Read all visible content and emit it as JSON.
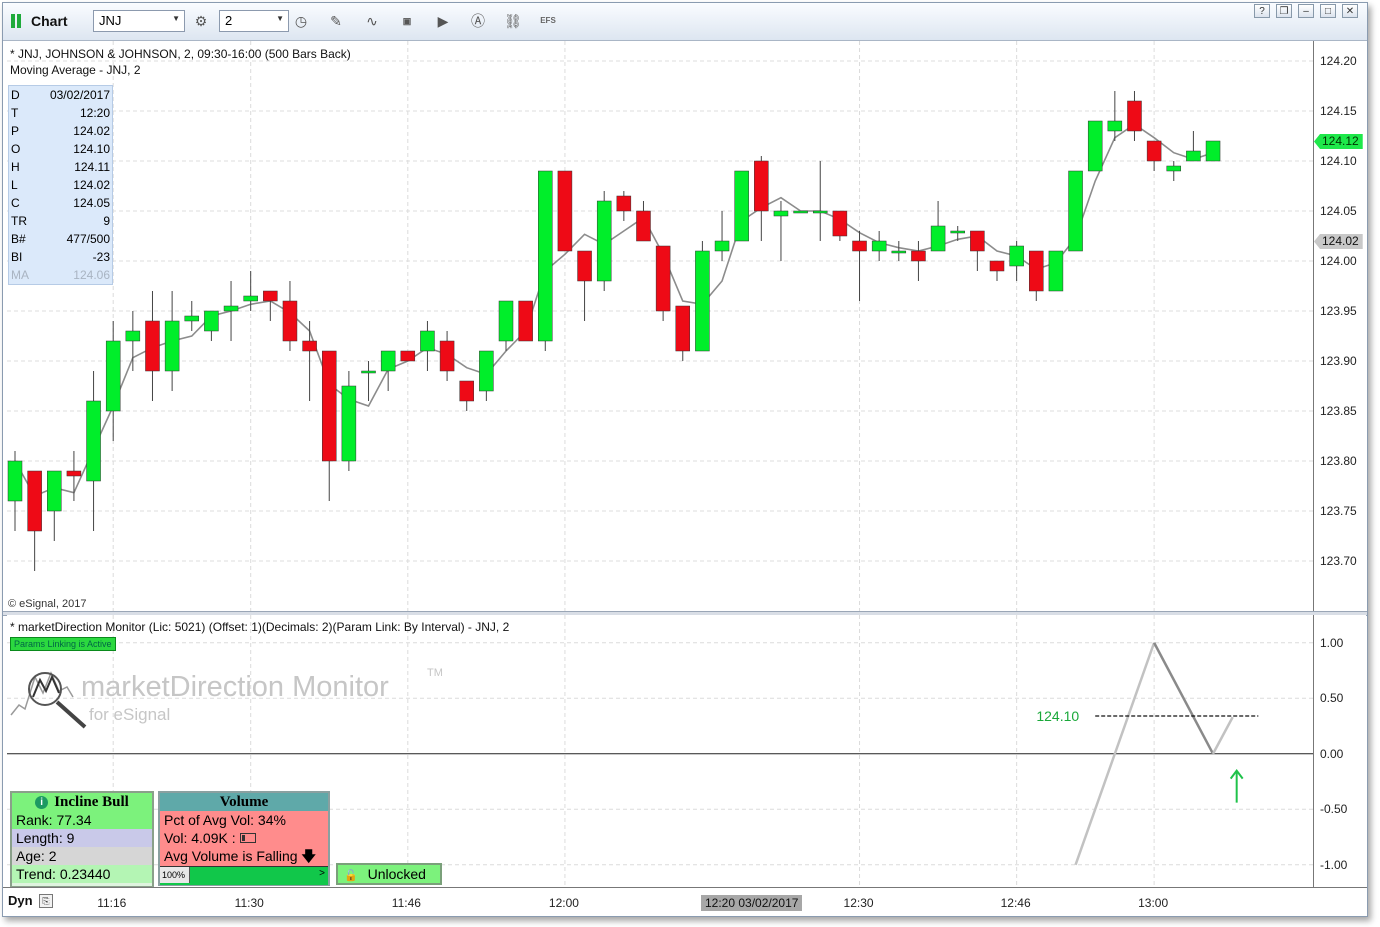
{
  "toolbar": {
    "app_title": "Chart",
    "symbol": "JNJ",
    "interval": "2",
    "efs_label": "EFS",
    "icons": [
      "settings-icon",
      "clock-icon",
      "pencil-icon",
      "study-icon",
      "get-icon",
      "play-icon",
      "alert-icon",
      "link-icon"
    ]
  },
  "window_buttons": [
    "?",
    "❐",
    "–",
    "□",
    "✕"
  ],
  "price_pane": {
    "header1": "* JNJ, JOHNSON & JOHNSON, 2, 09:30-16:00 (500 Bars Back)",
    "header2": "Moving Average - JNJ, 2",
    "copyright": "© eSignal, 2017",
    "cursor_window": [
      {
        "k": "D",
        "v": "03/02/2017"
      },
      {
        "k": "T",
        "v": "12:20"
      },
      {
        "k": "P",
        "v": "124.02"
      },
      {
        "k": "O",
        "v": "124.10"
      },
      {
        "k": "H",
        "v": "124.11"
      },
      {
        "k": "L",
        "v": "124.02"
      },
      {
        "k": "C",
        "v": "124.05"
      },
      {
        "k": "TR",
        "v": "9"
      },
      {
        "k": "B#",
        "v": "477/500"
      },
      {
        "k": "BI",
        "v": "-23"
      },
      {
        "k": "MA",
        "v": "124.06"
      }
    ],
    "axis_labels": [
      "124.20",
      "124.15",
      "124.10",
      "124.05",
      "124.00",
      "123.95",
      "123.90",
      "123.85",
      "123.80",
      "123.75",
      "123.70"
    ],
    "last_price": "124.12",
    "cursor_price": "124.02",
    "up_color": "#00ee2a",
    "down_color": "#ee0a16"
  },
  "chart_data": {
    "type": "candlestick",
    "ylim": [
      123.65,
      124.22
    ],
    "x_ticks": [
      "11:16",
      "11:30",
      "11:46",
      "12:00",
      "12:30",
      "12:46",
      "13:00"
    ],
    "cursor_time": "12:20 03/02/2017",
    "bars": [
      {
        "o": 123.76,
        "h": 123.81,
        "l": 123.73,
        "c": 123.8
      },
      {
        "o": 123.79,
        "h": 123.79,
        "l": 123.69,
        "c": 123.73
      },
      {
        "o": 123.75,
        "h": 123.79,
        "l": 123.72,
        "c": 123.79
      },
      {
        "o": 123.79,
        "h": 123.81,
        "l": 123.76,
        "c": 123.785
      },
      {
        "o": 123.78,
        "h": 123.89,
        "l": 123.73,
        "c": 123.86
      },
      {
        "o": 123.85,
        "h": 123.94,
        "l": 123.82,
        "c": 123.92
      },
      {
        "o": 123.92,
        "h": 123.95,
        "l": 123.89,
        "c": 123.93
      },
      {
        "o": 123.94,
        "h": 123.97,
        "l": 123.86,
        "c": 123.89
      },
      {
        "o": 123.89,
        "h": 123.97,
        "l": 123.87,
        "c": 123.94
      },
      {
        "o": 123.94,
        "h": 123.96,
        "l": 123.93,
        "c": 123.945
      },
      {
        "o": 123.93,
        "h": 123.95,
        "l": 123.92,
        "c": 123.95
      },
      {
        "o": 123.95,
        "h": 123.98,
        "l": 123.92,
        "c": 123.955
      },
      {
        "o": 123.96,
        "h": 123.99,
        "l": 123.95,
        "c": 123.965
      },
      {
        "o": 123.97,
        "h": 123.97,
        "l": 123.94,
        "c": 123.96
      },
      {
        "o": 123.96,
        "h": 123.98,
        "l": 123.91,
        "c": 123.92
      },
      {
        "o": 123.92,
        "h": 123.94,
        "l": 123.86,
        "c": 123.91
      },
      {
        "o": 123.91,
        "h": 123.91,
        "l": 123.76,
        "c": 123.8
      },
      {
        "o": 123.8,
        "h": 123.89,
        "l": 123.79,
        "c": 123.875
      },
      {
        "o": 123.89,
        "h": 123.9,
        "l": 123.86,
        "c": 123.89
      },
      {
        "o": 123.89,
        "h": 123.91,
        "l": 123.87,
        "c": 123.91
      },
      {
        "o": 123.91,
        "h": 123.91,
        "l": 123.9,
        "c": 123.9
      },
      {
        "o": 123.91,
        "h": 123.94,
        "l": 123.89,
        "c": 123.93
      },
      {
        "o": 123.92,
        "h": 123.93,
        "l": 123.88,
        "c": 123.89
      },
      {
        "o": 123.88,
        "h": 123.88,
        "l": 123.85,
        "c": 123.86
      },
      {
        "o": 123.87,
        "h": 123.91,
        "l": 123.86,
        "c": 123.91
      },
      {
        "o": 123.92,
        "h": 123.96,
        "l": 123.91,
        "c": 123.96
      },
      {
        "o": 123.96,
        "h": 123.96,
        "l": 123.92,
        "c": 123.92
      },
      {
        "o": 123.92,
        "h": 124.09,
        "l": 123.91,
        "c": 124.09
      },
      {
        "o": 124.09,
        "h": 124.09,
        "l": 124.01,
        "c": 124.01
      },
      {
        "o": 124.01,
        "h": 124.01,
        "l": 123.94,
        "c": 123.98
      },
      {
        "o": 123.98,
        "h": 124.07,
        "l": 123.97,
        "c": 124.06
      },
      {
        "o": 124.065,
        "h": 124.07,
        "l": 124.04,
        "c": 124.05
      },
      {
        "o": 124.05,
        "h": 124.06,
        "l": 124.02,
        "c": 124.02
      },
      {
        "o": 124.015,
        "h": 124.015,
        "l": 123.94,
        "c": 123.95
      },
      {
        "o": 123.955,
        "h": 123.955,
        "l": 123.9,
        "c": 123.91
      },
      {
        "o": 123.91,
        "h": 124.02,
        "l": 123.91,
        "c": 124.01
      },
      {
        "o": 124.01,
        "h": 124.05,
        "l": 124.0,
        "c": 124.02
      },
      {
        "o": 124.02,
        "h": 124.09,
        "l": 124.02,
        "c": 124.09
      },
      {
        "o": 124.1,
        "h": 124.105,
        "l": 124.02,
        "c": 124.05
      },
      {
        "o": 124.045,
        "h": 124.06,
        "l": 124.0,
        "c": 124.05
      },
      {
        "o": 124.05,
        "h": 124.05,
        "l": 124.05,
        "c": 124.05
      },
      {
        "o": 124.05,
        "h": 124.1,
        "l": 124.02,
        "c": 124.05
      },
      {
        "o": 124.05,
        "h": 124.05,
        "l": 124.02,
        "c": 124.025
      },
      {
        "o": 124.02,
        "h": 124.03,
        "l": 123.96,
        "c": 124.01
      },
      {
        "o": 124.01,
        "h": 124.03,
        "l": 124.0,
        "c": 124.02
      },
      {
        "o": 124.01,
        "h": 124.02,
        "l": 124.0,
        "c": 124.01
      },
      {
        "o": 124.01,
        "h": 124.02,
        "l": 123.98,
        "c": 124.0
      },
      {
        "o": 124.01,
        "h": 124.06,
        "l": 124.01,
        "c": 124.035
      },
      {
        "o": 124.03,
        "h": 124.035,
        "l": 124.02,
        "c": 124.03
      },
      {
        "o": 124.03,
        "h": 124.03,
        "l": 123.99,
        "c": 124.01
      },
      {
        "o": 124.0,
        "h": 124.0,
        "l": 123.98,
        "c": 123.99
      },
      {
        "o": 123.995,
        "h": 124.02,
        "l": 123.98,
        "c": 124.015
      },
      {
        "o": 124.01,
        "h": 124.01,
        "l": 123.96,
        "c": 123.97
      },
      {
        "o": 123.97,
        "h": 124.01,
        "l": 123.97,
        "c": 124.01
      },
      {
        "o": 124.01,
        "h": 124.09,
        "l": 124.01,
        "c": 124.09
      },
      {
        "o": 124.09,
        "h": 124.14,
        "l": 124.09,
        "c": 124.14
      },
      {
        "o": 124.13,
        "h": 124.17,
        "l": 124.12,
        "c": 124.14
      },
      {
        "o": 124.16,
        "h": 124.17,
        "l": 124.12,
        "c": 124.13
      },
      {
        "o": 124.12,
        "h": 124.12,
        "l": 124.09,
        "c": 124.1
      },
      {
        "o": 124.09,
        "h": 124.1,
        "l": 124.08,
        "c": 124.095
      },
      {
        "o": 124.1,
        "h": 124.13,
        "l": 124.1,
        "c": 124.11
      },
      {
        "o": 124.1,
        "h": 124.12,
        "l": 124.1,
        "c": 124.12
      }
    ]
  },
  "indicator_pane": {
    "header": "* marketDirection Monitor (Lic: 5021) (Offset: 1)(Decimals: 2)(Param Link: By Interval) - JNJ, 2",
    "badge": "Params Linking is Active",
    "logo_text": "marketDirection Monitor",
    "logo_tm": "TM",
    "logo_sub": "for eSignal",
    "axis_labels": [
      "1.00",
      "0.50",
      "0.00",
      "-0.50",
      "-1.00"
    ],
    "ylim": [
      -1.2,
      1.25
    ],
    "line": [
      {
        "i": 54,
        "v": -1.0
      },
      {
        "i": 58,
        "v": 1.0
      },
      {
        "i": 61,
        "v": 0.0
      },
      {
        "i": 62,
        "v": 0.33
      }
    ],
    "target_label": "124.10",
    "target_level": 0.34,
    "target_start": 55,
    "target_end": 63,
    "arrow_index": 62,
    "arrow_level": -0.35,
    "trend_panel": {
      "title": "Incline Bull",
      "rows": [
        "Rank: 77.34",
        "Length: 9",
        "Age: 2",
        "Trend: 0.23440"
      ]
    },
    "volume_panel": {
      "title": "Volume",
      "rows": [
        "Pct of Avg Vol: 34%",
        "Vol: 4.09K :",
        "Avg Volume is Falling"
      ],
      "bar_label": "100%"
    },
    "lock_label": "Unlocked"
  },
  "x_axis": {
    "dyn_label": "Dyn",
    "dyn_icon": "⎘"
  }
}
